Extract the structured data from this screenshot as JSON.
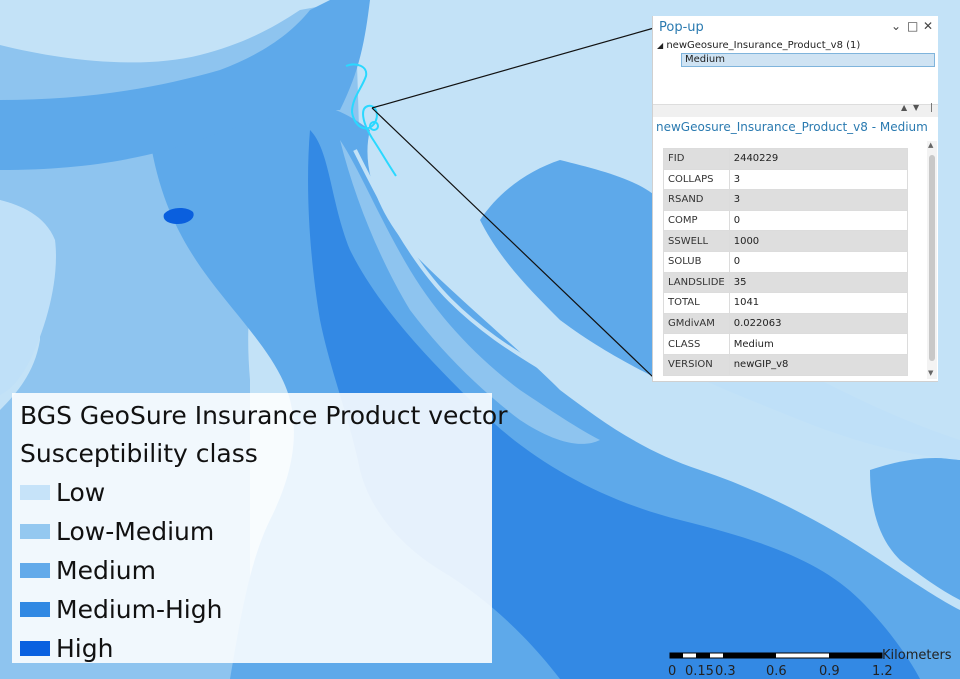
{
  "map": {
    "colors": {
      "background": "#c3e2f7",
      "low": "#bfe0f8",
      "low_medium": "#8ec4ef",
      "medium": "#5ea9ea",
      "medium_high": "#3389e4",
      "high": "#0a5fde",
      "highlight": "#2ad8ff"
    }
  },
  "legend": {
    "title": "BGS GeoSure Insurance Product vector",
    "subtitle": "Susceptibility class",
    "items": [
      {
        "label": "Low",
        "color": "#c6e3f9"
      },
      {
        "label": "Low-Medium",
        "color": "#94c8f0"
      },
      {
        "label": "Medium",
        "color": "#62aaea"
      },
      {
        "label": "Medium-High",
        "color": "#3189e3"
      },
      {
        "label": "High",
        "color": "#0a61e0"
      }
    ]
  },
  "popup": {
    "title": "Pop-up",
    "controls": {
      "collapse": "⌄",
      "maximize": "□",
      "close": "✕"
    },
    "tree_node": "newGeosure_Insurance_Product_v8 (1)",
    "selected_feature": "Medium",
    "feature_header": "newGeosure_Insurance_Product_v8 - Medium",
    "attributes": [
      {
        "field": "FID",
        "value": "2440229"
      },
      {
        "field": "COLLAPS",
        "value": "3"
      },
      {
        "field": "RSAND",
        "value": "3"
      },
      {
        "field": "COMP",
        "value": "0"
      },
      {
        "field": "SSWELL",
        "value": "1000"
      },
      {
        "field": "SOLUB",
        "value": "0"
      },
      {
        "field": "LANDSLIDE",
        "value": "35"
      },
      {
        "field": "TOTAL",
        "value": "1041"
      },
      {
        "field": "GMdivAM",
        "value": "0.022063"
      },
      {
        "field": "CLASS",
        "value": "Medium"
      },
      {
        "field": "VERSION",
        "value": "newGIP_v8"
      }
    ]
  },
  "scalebar": {
    "unit": "Kilometers",
    "labels": [
      "0",
      "0.15",
      "0.3",
      "0.6",
      "0.9",
      "1.2"
    ]
  }
}
